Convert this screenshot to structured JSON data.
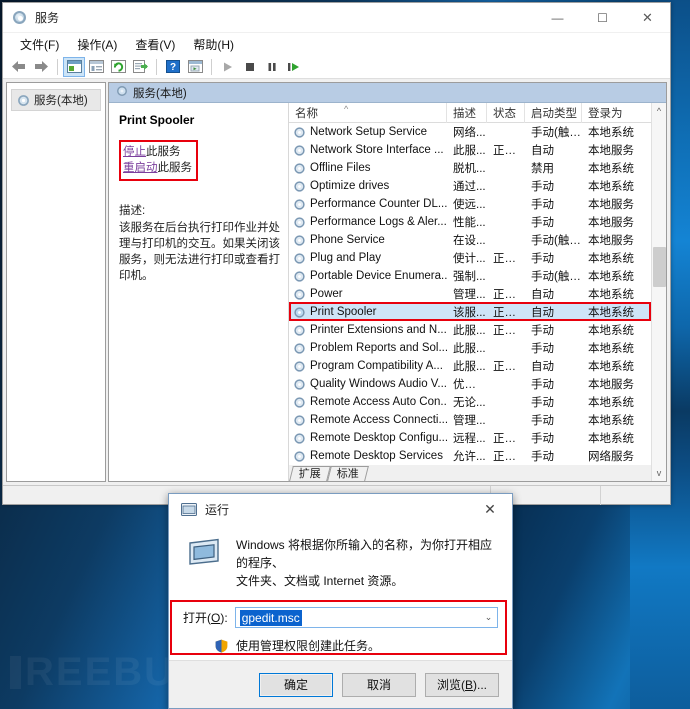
{
  "window": {
    "title": "服务",
    "icon": "services-gear-icon",
    "minimize": "—",
    "maximize": "☐",
    "close": "✕",
    "menus": [
      "文件(F)",
      "操作(A)",
      "查看(V)",
      "帮助(H)"
    ],
    "toolbar_icons": [
      "back-arrow-icon",
      "forward-arrow-icon",
      "show-tree-icon",
      "properties-icon",
      "refresh-icon",
      "export-list-icon",
      "help-icon",
      "console-icon",
      "start-service-icon",
      "stop-service-icon",
      "pause-service-icon",
      "restart-service-icon"
    ]
  },
  "tree": {
    "root_label": "服务(本地)",
    "root_icon": "services-gear-icon"
  },
  "pane": {
    "header_label": "服务(本地)",
    "header_icon": "services-gear-icon"
  },
  "detail": {
    "service_name": "Print Spooler",
    "action_stop_link": "停止",
    "action_stop_rest": "此服务",
    "action_restart_link": "重启动",
    "action_restart_rest": "此服务",
    "desc_label": "描述:",
    "desc_text": "该服务在后台执行打印作业并处理与打印机的交互。如果关闭该服务，则无法进行打印或查看打印机。"
  },
  "list": {
    "columns": [
      "名称",
      "描述",
      "状态",
      "启动类型",
      "登录为"
    ],
    "sort_indicator": "^",
    "rows": [
      {
        "name": "Network Setup Service",
        "desc": "网络...",
        "status": "",
        "startup": "手动(触发...",
        "logon": "本地系统",
        "selected": false
      },
      {
        "name": "Network Store Interface ...",
        "desc": "此服...",
        "status": "正在...",
        "startup": "自动",
        "logon": "本地服务",
        "selected": false
      },
      {
        "name": "Offline Files",
        "desc": "脱机...",
        "status": "",
        "startup": "禁用",
        "logon": "本地系统",
        "selected": false
      },
      {
        "name": "Optimize drives",
        "desc": "通过...",
        "status": "",
        "startup": "手动",
        "logon": "本地系统",
        "selected": false
      },
      {
        "name": "Performance Counter DL...",
        "desc": "使远...",
        "status": "",
        "startup": "手动",
        "logon": "本地服务",
        "selected": false
      },
      {
        "name": "Performance Logs & Aler...",
        "desc": "性能...",
        "status": "",
        "startup": "手动",
        "logon": "本地服务",
        "selected": false
      },
      {
        "name": "Phone Service",
        "desc": "在设...",
        "status": "",
        "startup": "手动(触发...",
        "logon": "本地服务",
        "selected": false
      },
      {
        "name": "Plug and Play",
        "desc": "使计...",
        "status": "正在...",
        "startup": "手动",
        "logon": "本地系统",
        "selected": false
      },
      {
        "name": "Portable Device Enumera...",
        "desc": "强制...",
        "status": "",
        "startup": "手动(触发...",
        "logon": "本地系统",
        "selected": false
      },
      {
        "name": "Power",
        "desc": "管理...",
        "status": "正在...",
        "startup": "自动",
        "logon": "本地系统",
        "selected": false
      },
      {
        "name": "Print Spooler",
        "desc": "该服...",
        "status": "正在...",
        "startup": "自动",
        "logon": "本地系统",
        "selected": true
      },
      {
        "name": "Printer Extensions and N...",
        "desc": "此服...",
        "status": "正在...",
        "startup": "手动",
        "logon": "本地系统",
        "selected": false
      },
      {
        "name": "Problem Reports and Sol...",
        "desc": "此服...",
        "status": "",
        "startup": "手动",
        "logon": "本地系统",
        "selected": false
      },
      {
        "name": "Program Compatibility A...",
        "desc": "此服...",
        "status": "正在...",
        "startup": "自动",
        "logon": "本地系统",
        "selected": false
      },
      {
        "name": "Quality Windows Audio V...",
        "desc": "优质 ...",
        "status": "",
        "startup": "手动",
        "logon": "本地服务",
        "selected": false
      },
      {
        "name": "Remote Access Auto Con...",
        "desc": "无论...",
        "status": "",
        "startup": "手动",
        "logon": "本地系统",
        "selected": false
      },
      {
        "name": "Remote Access Connecti...",
        "desc": "管理...",
        "status": "",
        "startup": "手动",
        "logon": "本地系统",
        "selected": false
      },
      {
        "name": "Remote Desktop Configu...",
        "desc": "远程...",
        "status": "正在...",
        "startup": "手动",
        "logon": "本地系统",
        "selected": false
      },
      {
        "name": "Remote Desktop Services",
        "desc": "允许...",
        "status": "正在...",
        "startup": "手动",
        "logon": "网络服务",
        "selected": false
      }
    ],
    "scroll_up": "^",
    "scroll_down": "v"
  },
  "tabs": [
    "扩展",
    "标准"
  ],
  "dialog": {
    "title": "运行",
    "icon": "run-window-icon",
    "close": "✕",
    "info_line1": "Windows 将根据你所输入的名称，为你打开相应的程序、",
    "info_line2": "文件夹、文档或 Internet 资源。",
    "open_label_pre": "打开(",
    "open_label_key": "O",
    "open_label_post": "):",
    "input_value": "gpedit.msc",
    "caret": "⌄",
    "admin_note": "使用管理权限创建此任务。",
    "admin_icon": "shield-icon",
    "buttons": {
      "ok": "确定",
      "cancel": "取消",
      "browse_pre": "浏览(",
      "browse_key": "B",
      "browse_post": ")..."
    }
  },
  "watermark": {
    "text": "REEBUF"
  },
  "colors": {
    "highlight_red": "#e8000d",
    "selection_blue": "#cfe4f7",
    "link_purple": "#7b3f9d",
    "accent_blue": "#0078d7"
  }
}
